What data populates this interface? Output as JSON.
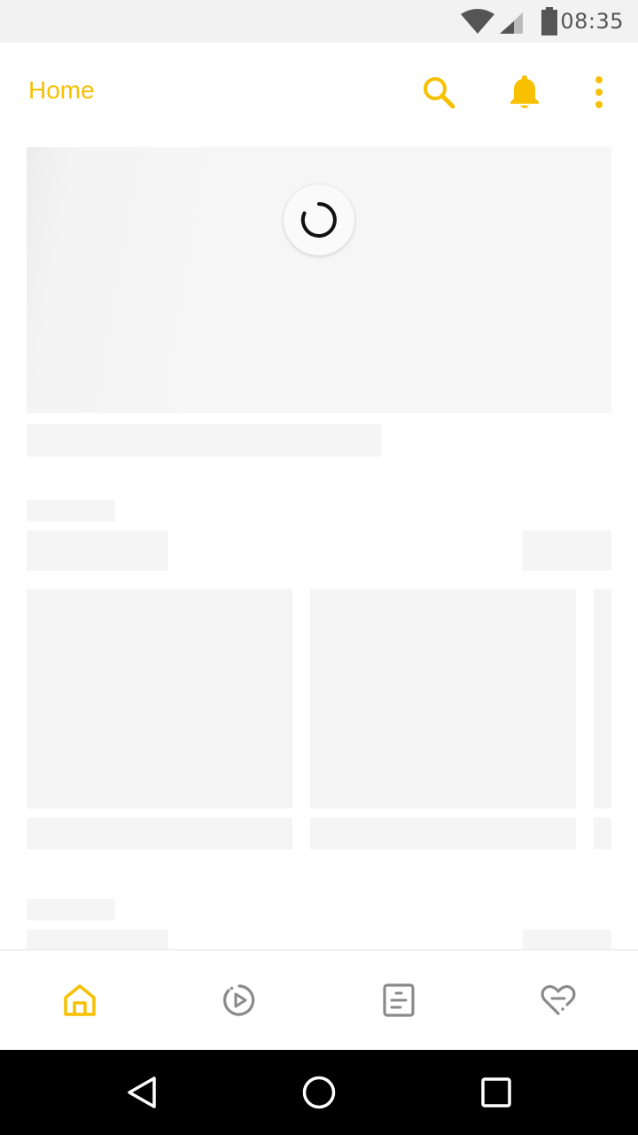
{
  "status_bar": {
    "time": "08:35",
    "icons": [
      "wifi-icon",
      "cell-signal-icon",
      "battery-icon"
    ]
  },
  "app_bar": {
    "title": "Home",
    "actions": [
      "search-icon",
      "bell-icon",
      "more-vert-icon"
    ]
  },
  "content": {
    "state": "loading",
    "spinner": "loading-spinner-icon"
  },
  "bottom_nav": {
    "items": [
      {
        "icon": "home-icon",
        "active": true
      },
      {
        "icon": "play-circle-icon",
        "active": false
      },
      {
        "icon": "list-icon",
        "active": false
      },
      {
        "icon": "heart-icon",
        "active": false
      }
    ]
  },
  "system_nav": [
    "back-icon",
    "home-circle-icon",
    "recents-icon"
  ],
  "colors": {
    "accent": "#f7c000",
    "skeleton": "#f5f5f5",
    "inactive_icon": "#8a8a8a",
    "status_bar_bg": "#f2f2f2"
  }
}
